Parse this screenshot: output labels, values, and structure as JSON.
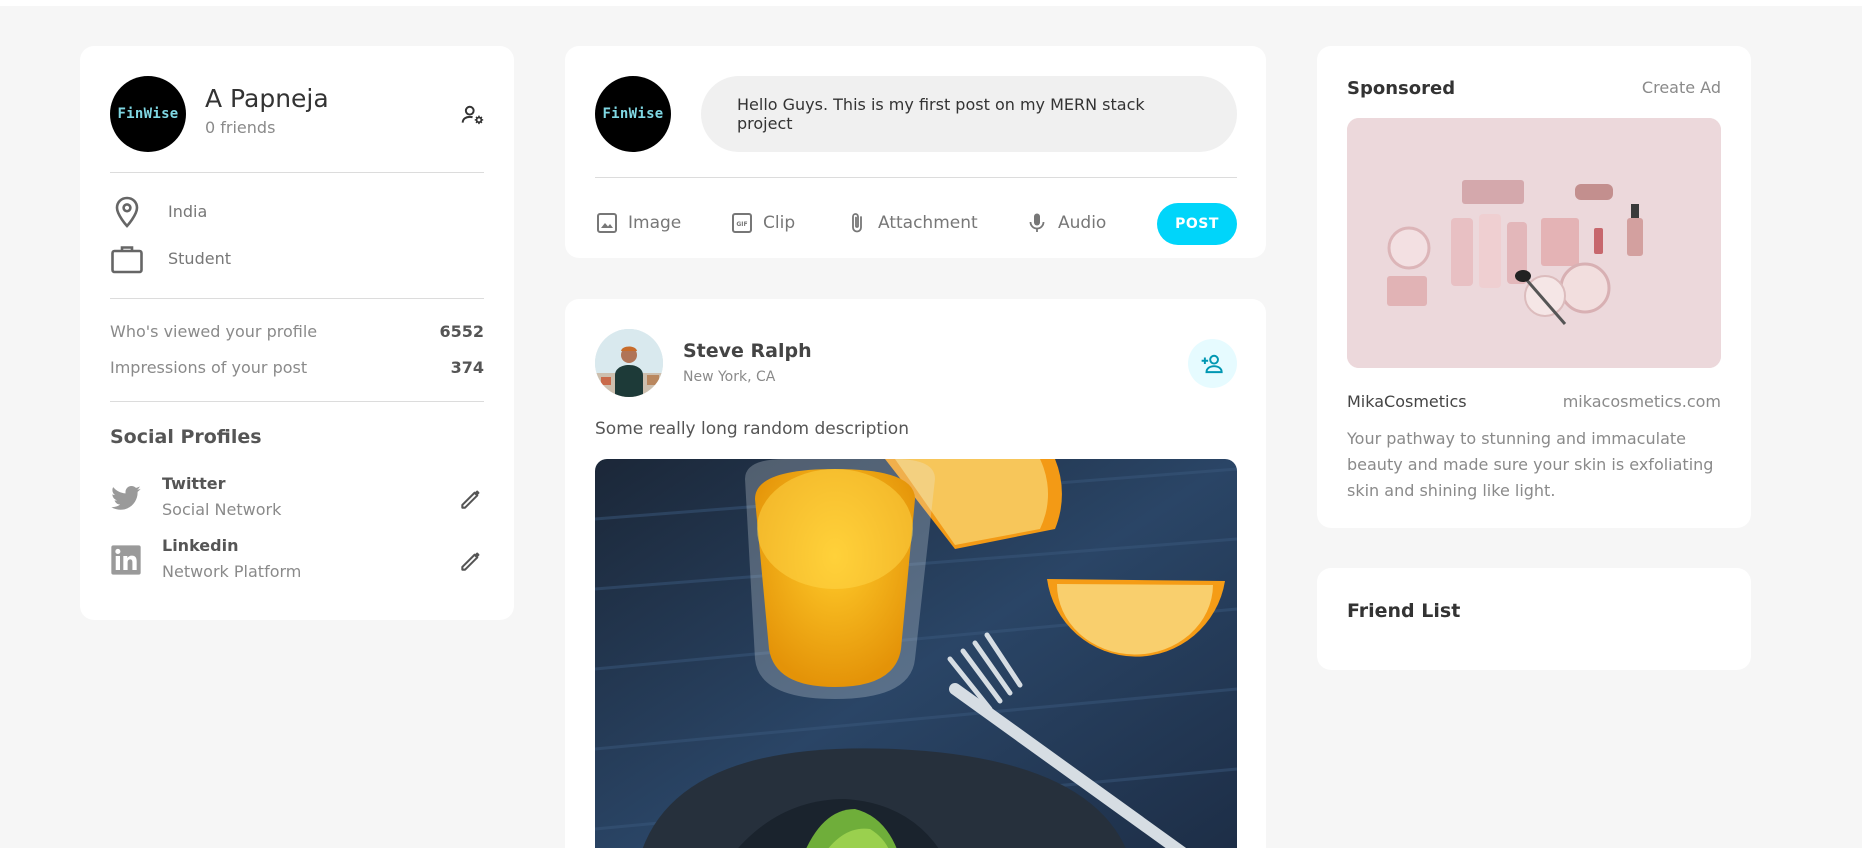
{
  "profile": {
    "avatar_text": "FinWise",
    "name": "A Papneja",
    "friends": "0 friends",
    "location": "India",
    "occupation": "Student",
    "stats": [
      {
        "label": "Who's viewed your profile",
        "value": "6552"
      },
      {
        "label": "Impressions of your post",
        "value": "374"
      }
    ],
    "social_title": "Social Profiles",
    "socials": [
      {
        "name": "Twitter",
        "type": "Social Network",
        "icon": "twitter-icon"
      },
      {
        "name": "Linkedin",
        "type": "Network Platform",
        "icon": "linkedin-icon"
      }
    ]
  },
  "composer": {
    "avatar_text": "FinWise",
    "input_value": "Hello Guys. This is my first post on my MERN stack project",
    "tools": [
      {
        "label": "Image",
        "icon": "image-icon"
      },
      {
        "label": "Clip",
        "icon": "gif-icon"
      },
      {
        "label": "Attachment",
        "icon": "paperclip-icon"
      },
      {
        "label": "Audio",
        "icon": "microphone-icon"
      }
    ],
    "post_button": "POST",
    "accent": "#00d5fa"
  },
  "post": {
    "author": "Steve Ralph",
    "location": "New York, CA",
    "description": "Some really long random description"
  },
  "ad": {
    "title": "Sponsored",
    "create": "Create Ad",
    "brand": "MikaCosmetics",
    "site": "mikacosmetics.com",
    "description": "Your pathway to stunning and immaculate beauty and made sure your skin is exfoliating skin and shining like light."
  },
  "friends": {
    "title": "Friend List"
  }
}
